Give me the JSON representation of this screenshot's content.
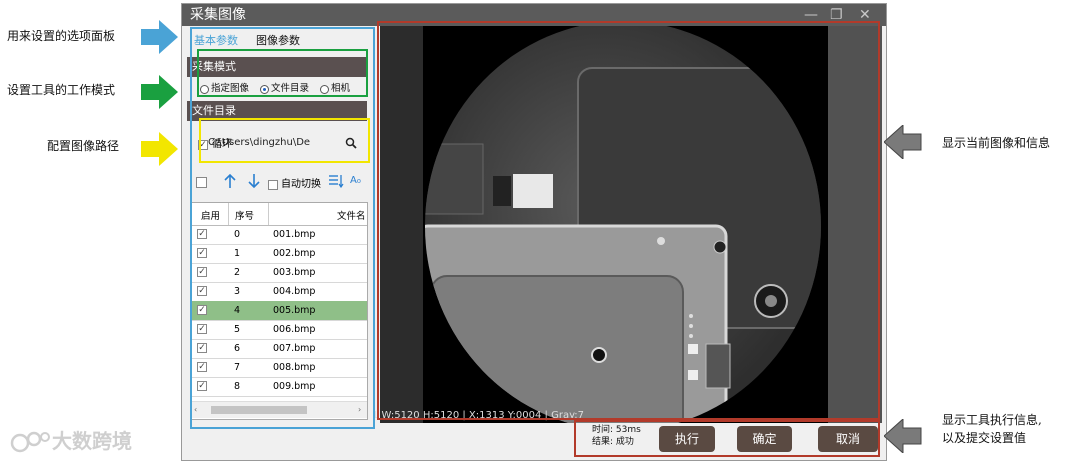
{
  "window": {
    "title": "采集图像",
    "minimize": "—",
    "maximize": "❐",
    "close": "✕"
  },
  "tabs": [
    {
      "label": "基本参数"
    },
    {
      "label": "图像参数"
    }
  ],
  "capture_mode": {
    "title": "采集模式",
    "options": [
      {
        "label": "指定图像",
        "selected": false
      },
      {
        "label": "文件目录",
        "selected": true
      },
      {
        "label": "相机",
        "selected": false
      }
    ]
  },
  "file_dir": {
    "title": "文件目录",
    "loop_label": "循环",
    "path_value": "C:\\Users\\dingzhu\\De"
  },
  "toolbar": {
    "auto_switch": "自动切换",
    "sort_label": "A₀"
  },
  "table": {
    "headers": [
      "启用",
      "序号",
      "文件名"
    ],
    "rows": [
      {
        "idx": "0",
        "name": "001.bmp"
      },
      {
        "idx": "1",
        "name": "002.bmp"
      },
      {
        "idx": "2",
        "name": "003.bmp"
      },
      {
        "idx": "3",
        "name": "004.bmp"
      },
      {
        "idx": "4",
        "name": "005.bmp"
      },
      {
        "idx": "5",
        "name": "006.bmp"
      },
      {
        "idx": "6",
        "name": "007.bmp"
      },
      {
        "idx": "7",
        "name": "008.bmp"
      },
      {
        "idx": "8",
        "name": "009.bmp"
      }
    ],
    "selected_row": 4
  },
  "image": {
    "status_text": "1 W:5120 H:5120 | X:1313 Y:0004 | Gray:7"
  },
  "footer": {
    "time_label": "时间:",
    "time_value": "53ms",
    "result_label": "结果:",
    "result_value": "成功",
    "run_button": "执行",
    "ok_button": "确定",
    "cancel_button": "取消"
  },
  "annotations": {
    "panel": "用来设置的选项面板",
    "mode": "设置工具的工作模式",
    "path": "配置图像路径",
    "display": "显示当前图像和信息",
    "footer_line1": "显示工具执行信息,",
    "footer_line2": "以及提交设置值"
  },
  "watermark": "大数跨境",
  "colors": {
    "blue_arrow": "#4aa3d6",
    "green_arrow": "#1aa040",
    "yellow_arrow": "#f2e600",
    "gray_arrow": "#7a7a7a",
    "selected_row": "#8fbf88",
    "section_header": "#5a5050",
    "highlight_red": "#b23a2a"
  }
}
